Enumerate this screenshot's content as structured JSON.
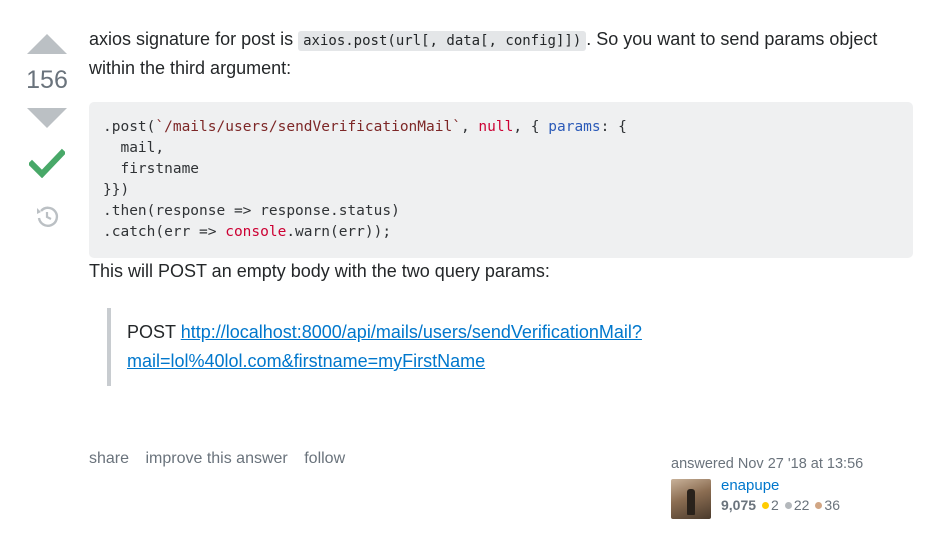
{
  "vote": {
    "count": "156"
  },
  "answer": {
    "intro_before": "axios signature for post is ",
    "intro_code": "axios.post(url[, data[, config]])",
    "intro_after": ". So you want to send params object within the third argument:",
    "para2": "This will POST an empty body with the two query params:",
    "quote_prefix": "POST ",
    "quote_link_line1": "http://localhost:8000/api/mails/users/sendVerificationMail?",
    "quote_link_line2": "mail=lol%40lol.com&firstname=myFirstName"
  },
  "code": {
    "l1_a": ".post(",
    "l1_str": "`/mails/users/sendVerificationMail`",
    "l1_b": ", ",
    "l1_null": "null",
    "l1_c": ", { ",
    "l1_params": "params",
    "l1_d": ": {",
    "l2": "  mail,",
    "l3": "  firstname",
    "l4": "}})",
    "l5": ".then(response => response.status)",
    "l6_a": ".catch(err => ",
    "l6_console": "console",
    "l6_b": ".warn(err));"
  },
  "menu": {
    "share": "share",
    "improve": "improve this answer",
    "follow": "follow"
  },
  "user": {
    "action": "answered Nov 27 '18 at 13:56",
    "name": "enapupe",
    "reputation": "9,075",
    "gold": "2",
    "silver": "22",
    "bronze": "36"
  },
  "colors": {
    "gold": "#ffcc01",
    "silver": "#b4b8bc",
    "bronze": "#d1a684",
    "link": "#0077cc",
    "accepted": "#48a868"
  }
}
